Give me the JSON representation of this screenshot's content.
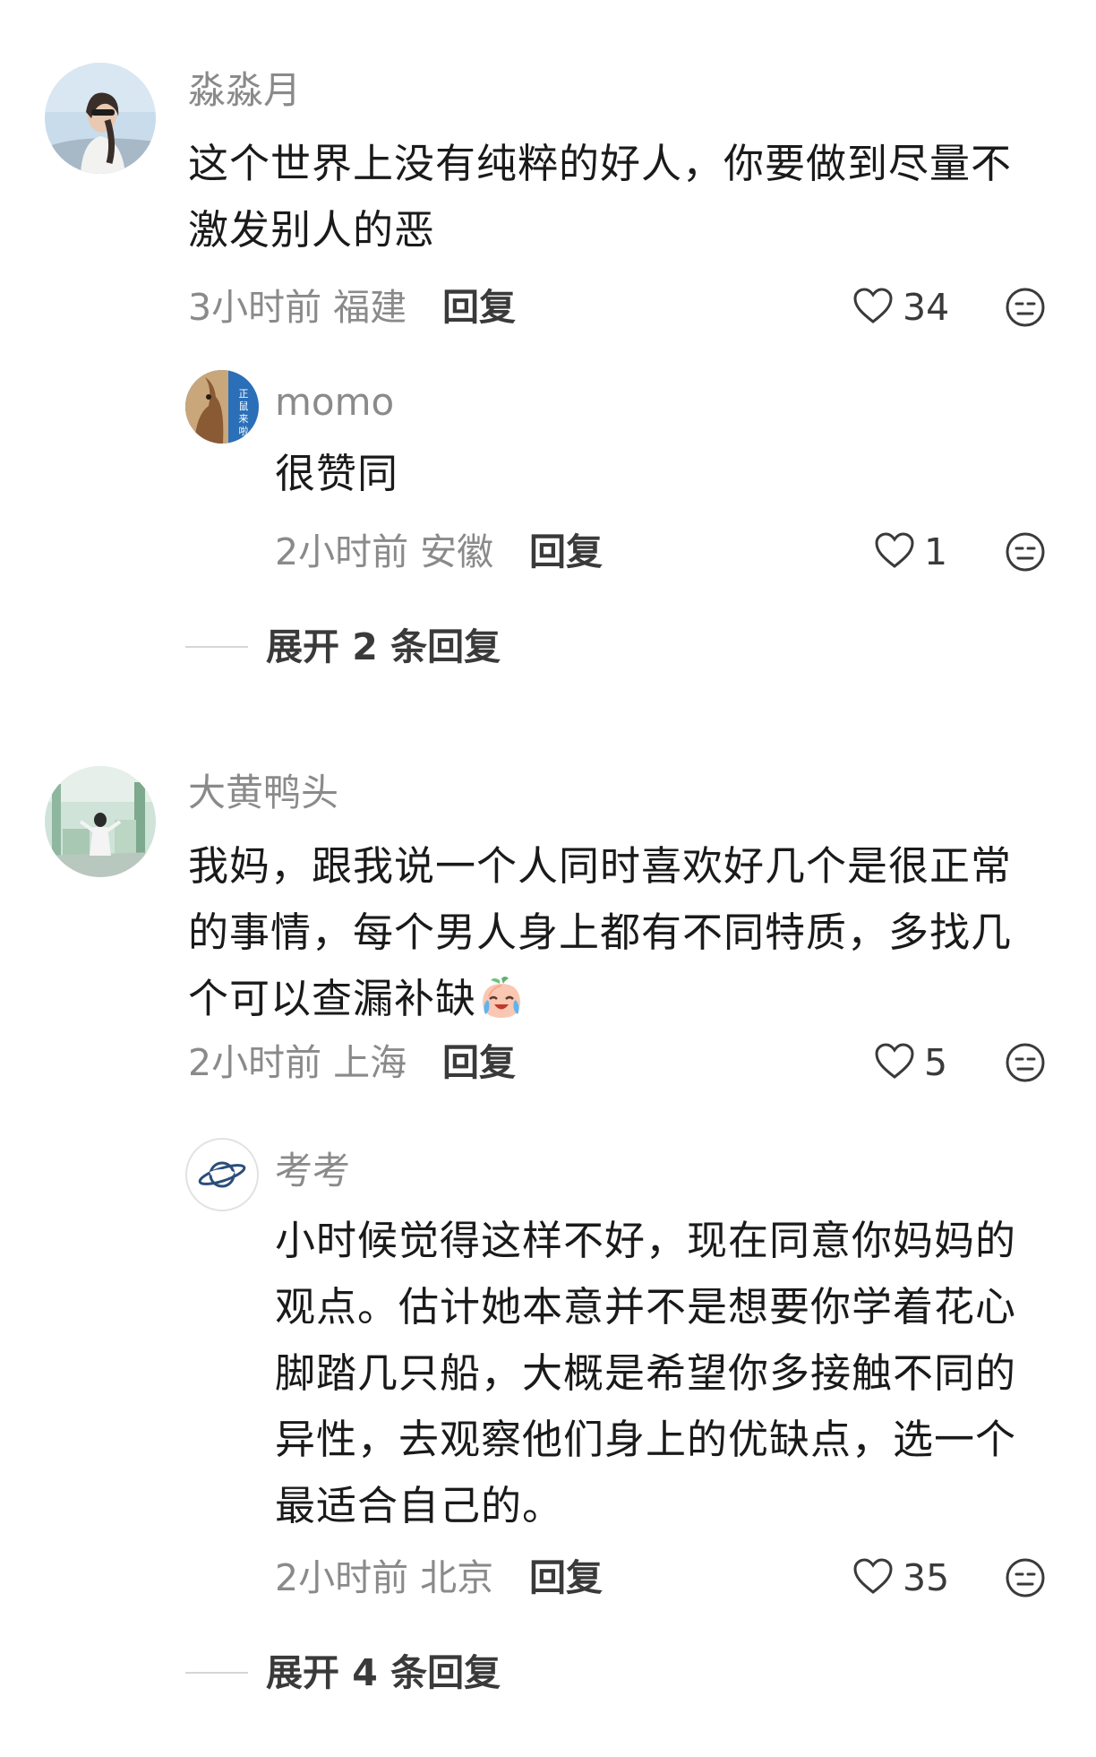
{
  "comments": [
    {
      "username": "淼淼月",
      "text": "这个世界上没有纯粹的好人，你要做到尽量不激发别人的恶",
      "time_location": "3小时前 福建",
      "reply_label": "回复",
      "likes": "34",
      "reply": {
        "username": "momo",
        "avatar_text": "正鼠来啦",
        "text": "很赞同",
        "time_location": "2小时前 安徽",
        "reply_label": "回复",
        "likes": "1"
      },
      "expand_label": "展开 2 条回复"
    },
    {
      "username": "大黄鸭头",
      "text": "我妈，跟我说一个人同时喜欢好几个是很正常的事情，每个男人身上都有不同特质，多找几个可以查漏补缺",
      "emoji": "crying-laughing-peach-emoji",
      "time_location": "2小时前 上海",
      "reply_label": "回复",
      "likes": "5",
      "reply": {
        "username": "考考",
        "text": "小时候觉得这样不好，现在同意你妈妈的观点。估计她本意并不是想要你学着花心脚踏几只船，大概是希望你多接触不同的异性，去观察他们身上的优缺点，选一个最适合自己的。",
        "time_location": "2小时前 北京",
        "reply_label": "回复",
        "likes": "35"
      },
      "expand_label": "展开 4 条回复"
    }
  ],
  "colors": {
    "username": "#8a8a8a",
    "text": "#1a1a1a",
    "meta": "#8a8a8a",
    "action": "#3a3a3a",
    "divider": "#d6d6d6"
  }
}
